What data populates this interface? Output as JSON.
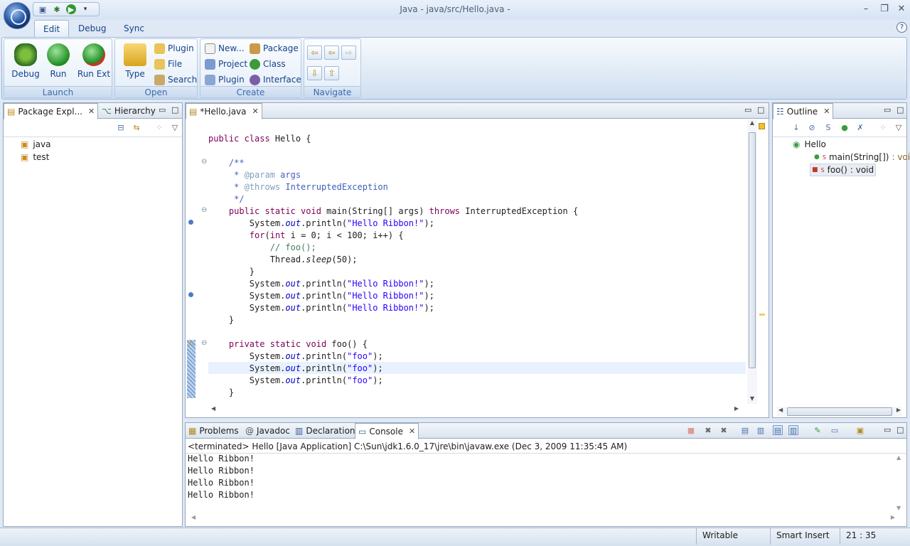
{
  "window": {
    "title": "Java - java/src/Hello.java -",
    "controls": {
      "minimize": "–",
      "maximize": "❐",
      "close": "✕"
    }
  },
  "ribbon": {
    "tabs": [
      {
        "label": "Edit",
        "active": true
      },
      {
        "label": "Debug"
      },
      {
        "label": "Sync"
      }
    ],
    "help_label": "?",
    "groups": {
      "launch": {
        "label": "Launch",
        "buttons": [
          "Debug",
          "Run",
          "Run Ext"
        ]
      },
      "open": {
        "label": "Open",
        "big": "Type",
        "small": [
          "Plugin",
          "File",
          "Search"
        ]
      },
      "create": {
        "label": "Create",
        "col1": [
          "New...",
          "Project",
          "Plugin"
        ],
        "col2": [
          "Package",
          "Class",
          "Interface"
        ]
      },
      "navigate": {
        "label": "Navigate"
      }
    }
  },
  "package_explorer": {
    "tabs": [
      "Package Expl...",
      "Hierarchy"
    ],
    "items": [
      "java",
      "test"
    ]
  },
  "editor": {
    "tab_label": "*Hello.java"
  },
  "outline": {
    "tab_label": "Outline",
    "class_name": "Hello",
    "members": [
      {
        "name": "main(String[])",
        "type": " : void",
        "modifier": "S"
      },
      {
        "name": "foo()",
        "type": " : void",
        "modifier": "S"
      }
    ]
  },
  "bottom": {
    "tabs": [
      "Problems",
      "Javadoc",
      "Declaration",
      "Console"
    ],
    "console_header": "<terminated> Hello [Java Application] C:\\Sun\\jdk1.6.0_17\\jre\\bin\\javaw.exe (Dec 3, 2009 11:35:45 AM)",
    "console_lines": [
      "Hello Ribbon!",
      "Hello Ribbon!",
      "Hello Ribbon!",
      "Hello Ribbon!"
    ]
  },
  "status": {
    "writable": "Writable",
    "insert_mode": "Smart Insert",
    "position": "21 : 35"
  },
  "colors": {
    "keyword": "#7f0055",
    "string": "#2a00ff",
    "comment": "#3f7f5f",
    "javadoc": "#3f5fbf",
    "field": "#0000c0",
    "ribbon_text": "#15428b"
  }
}
